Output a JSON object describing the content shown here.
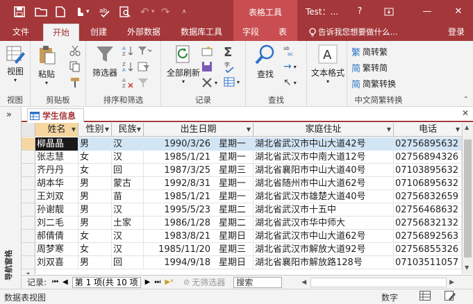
{
  "titlebar": {
    "context_tab": "表格工具",
    "title": "Test：...",
    "help": "?",
    "minimize": "—",
    "close": "✕"
  },
  "tabs": {
    "file": "文件",
    "home": "开始",
    "create": "创建",
    "external": "外部数据",
    "dbtools": "数据库工具",
    "fields": "字段",
    "table": "表",
    "tellme": "告诉我您想要做什么...",
    "signin": "登录"
  },
  "ribbon": {
    "view_btn": "视图",
    "view_group": "视图",
    "paste_btn": "粘贴",
    "clipboard_group": "剪贴板",
    "filter_btn": "筛选器",
    "sort_group": "排序和筛选",
    "refresh_btn": "全部刷新",
    "records_group": "记录",
    "find_btn": "查找",
    "find_group": "查找",
    "textformat_btn": "文本格式",
    "to_trad": "简转繁",
    "to_simp": "繁转简",
    "convert": "简繁转换",
    "convert_group": "中文简繁转换"
  },
  "nav_pane": {
    "label": "导航窗格",
    "toggle": "»"
  },
  "doc_tab": {
    "label": "学生信息",
    "close": "✕"
  },
  "table": {
    "columns": [
      "姓名",
      "性别",
      "民族",
      "出生日期",
      "家庭住址",
      "电话"
    ],
    "rows": [
      [
        "柳晶晶",
        "男",
        "汉",
        "1990/3/26",
        "星期一",
        "湖北省武汉市中山大道42号",
        "02756895632"
      ],
      [
        "张志慧",
        "女",
        "汉",
        "1985/1/21",
        "星期一",
        "湖北省武汉市中南大道12号",
        "02756894326"
      ],
      [
        "齐丹丹",
        "女",
        "回",
        "1987/3/25",
        "星期三",
        "湖北省襄阳市中山大道40号",
        "07103895632"
      ],
      [
        "胡本华",
        "男",
        "蒙古",
        "1992/8/31",
        "星期一",
        "湖北省随州市中山大道62号",
        "07106895632"
      ],
      [
        "王刘双",
        "男",
        "苗",
        "1985/1/21",
        "星期一",
        "湖北省武汉市雄楚大道40号",
        "02756832659"
      ],
      [
        "孙谢靓",
        "男",
        "汉",
        "1995/5/23",
        "星期二",
        "湖北省武汉市十五中",
        "02756468632"
      ],
      [
        "刘二毛",
        "男",
        "土家",
        "1986/1/28",
        "星期二",
        "湖北省武汉市华中师大",
        "02756832132"
      ],
      [
        "郝倩倩",
        "女",
        "汉",
        "1983/8/21",
        "星期日",
        "湖北省武汉市中山大道62号",
        "02756892563"
      ],
      [
        "周梦寒",
        "女",
        "汉",
        "1985/11/20",
        "星期三",
        "湖北省武汉市解放大道92号",
        "02756855326"
      ],
      [
        "刘双喜",
        "男",
        "回",
        "1994/9/18",
        "星期日",
        "湖北省襄阳市解放路128号",
        "07103511057"
      ]
    ],
    "new_row_marker": "*"
  },
  "record_nav": {
    "label": "记录:",
    "position": "第 1 项(共 10 项",
    "no_filter": "无筛选器",
    "search_placeholder": "搜索"
  },
  "status": {
    "left": "数据表视图",
    "numlock": "数字"
  },
  "colors": {
    "accent": "#a4373a",
    "selected_row": "#d2e5f5",
    "current_selector": "#f6d7a2"
  }
}
